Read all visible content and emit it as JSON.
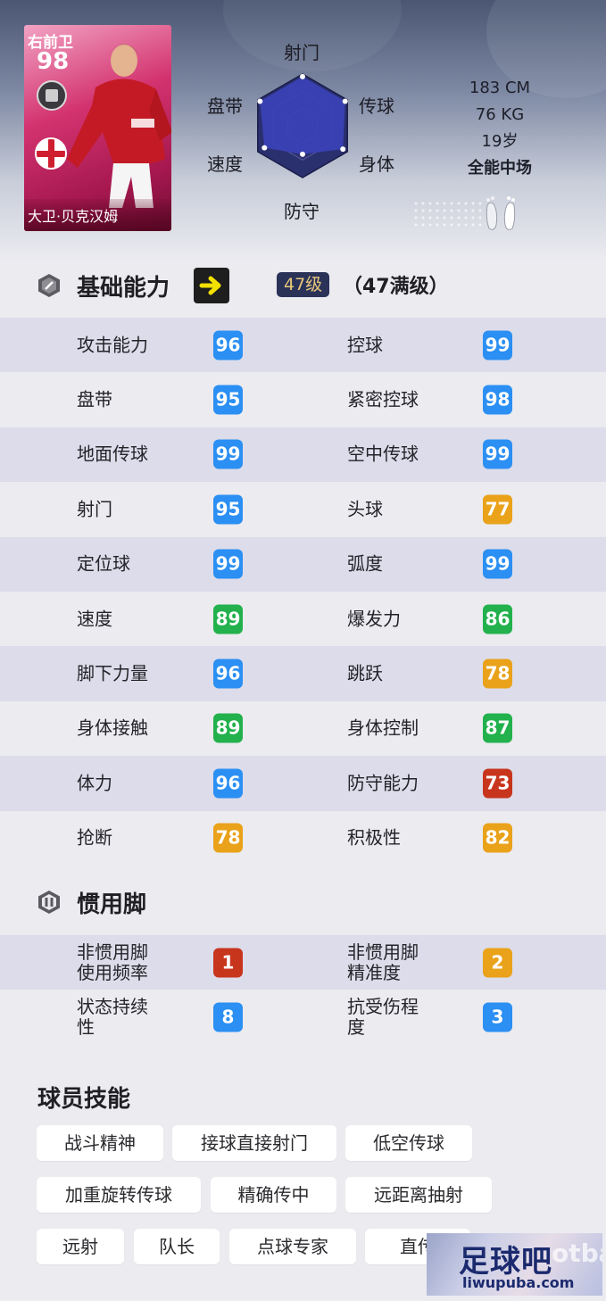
{
  "player": {
    "position": "右前卫",
    "overall": "98",
    "name": "大卫·贝克汉姆"
  },
  "radar": {
    "labels": {
      "top": "射门",
      "upper_right": "传球",
      "lower_right": "身体",
      "bottom": "防守",
      "lower_left": "速度",
      "upper_left": "盘带"
    },
    "values": [
      0.95,
      0.95,
      0.9,
      0.55,
      0.85,
      0.95
    ],
    "fill_color": "#3b43b8"
  },
  "physical": {
    "height": "183 CM",
    "weight": "76 KG",
    "age": "19岁",
    "role": "全能中场"
  },
  "basic": {
    "title": "基础能力",
    "level": "47级",
    "level_max": "（47满级）"
  },
  "colors": {
    "blue": "#2b8ff3",
    "green": "#22b14c",
    "orange": "#eaa21a",
    "red": "#c8351d"
  },
  "stats": [
    {
      "l_label": "攻击能力",
      "l_val": "96",
      "l_color": "#2b8ff3",
      "r_label": "控球",
      "r_val": "99",
      "r_color": "#2b8ff3"
    },
    {
      "l_label": "盘带",
      "l_val": "95",
      "l_color": "#2b8ff3",
      "r_label": "紧密控球",
      "r_val": "98",
      "r_color": "#2b8ff3"
    },
    {
      "l_label": "地面传球",
      "l_val": "99",
      "l_color": "#2b8ff3",
      "r_label": "空中传球",
      "r_val": "99",
      "r_color": "#2b8ff3"
    },
    {
      "l_label": "射门",
      "l_val": "95",
      "l_color": "#2b8ff3",
      "r_label": "头球",
      "r_val": "77",
      "r_color": "#eaa21a"
    },
    {
      "l_label": "定位球",
      "l_val": "99",
      "l_color": "#2b8ff3",
      "r_label": "弧度",
      "r_val": "99",
      "r_color": "#2b8ff3"
    },
    {
      "l_label": "速度",
      "l_val": "89",
      "l_color": "#22b14c",
      "r_label": "爆发力",
      "r_val": "86",
      "r_color": "#22b14c"
    },
    {
      "l_label": "脚下力量",
      "l_val": "96",
      "l_color": "#2b8ff3",
      "r_label": "跳跃",
      "r_val": "78",
      "r_color": "#eaa21a"
    },
    {
      "l_label": "身体接触",
      "l_val": "89",
      "l_color": "#22b14c",
      "r_label": "身体控制",
      "r_val": "87",
      "r_color": "#22b14c"
    },
    {
      "l_label": "体力",
      "l_val": "96",
      "l_color": "#2b8ff3",
      "r_label": "防守能力",
      "r_val": "73",
      "r_color": "#c8351d"
    },
    {
      "l_label": "抢断",
      "l_val": "78",
      "l_color": "#eaa21a",
      "r_label": "积极性",
      "r_val": "82",
      "r_color": "#eaa21a"
    }
  ],
  "foot": {
    "title": "惯用脚",
    "rows": [
      {
        "l_label": "非惯用脚\n使用频率",
        "l_val": "1",
        "l_color": "#c8351d",
        "r_label": "非惯用脚\n精准度",
        "r_val": "2",
        "r_color": "#eaa21a"
      },
      {
        "l_label": "状态持续\n性",
        "l_val": "8",
        "l_color": "#2b8ff3",
        "r_label": "抗受伤程\n度",
        "r_val": "3",
        "r_color": "#2b8ff3"
      }
    ]
  },
  "skills": {
    "title": "球员技能",
    "items": [
      "战斗精神",
      "接球直接射门",
      "低空传球",
      "加重旋转传球",
      "精确传中",
      "远距离抽射",
      "远射",
      "队长",
      "点球专家",
      "直传"
    ]
  },
  "watermark": {
    "main": "足球吧",
    "sub": "liwupuba.com"
  }
}
